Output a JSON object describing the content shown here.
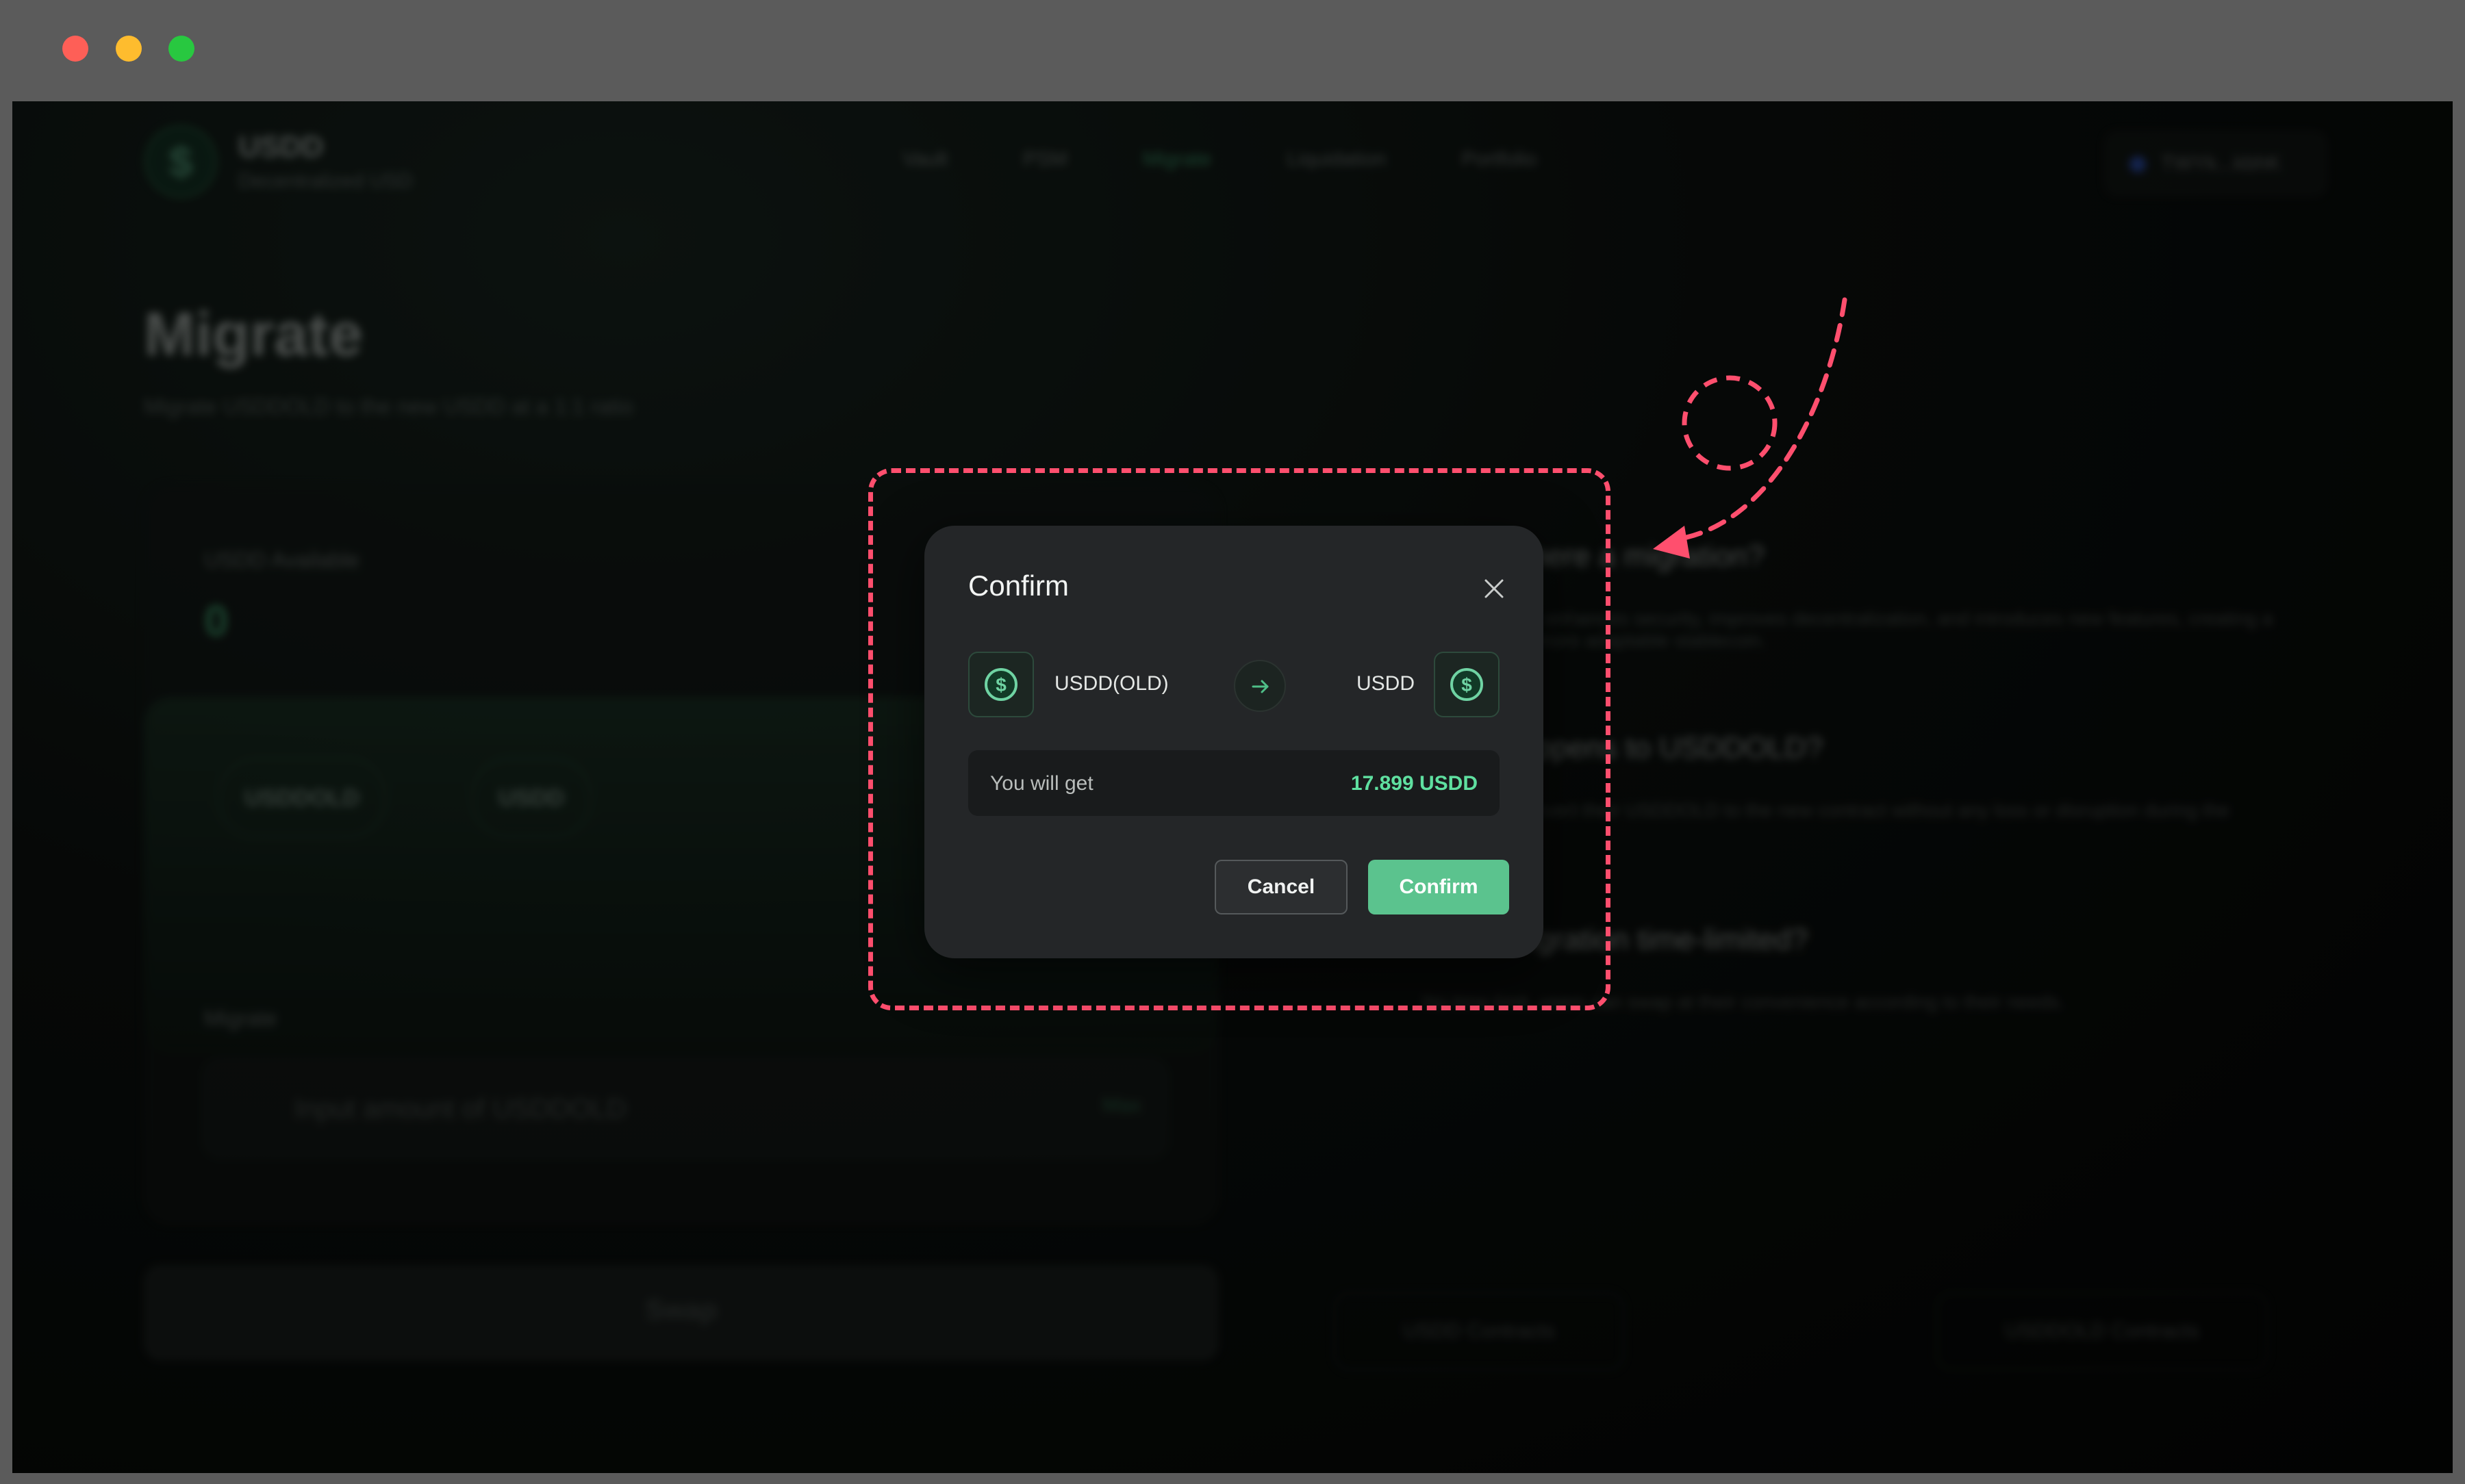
{
  "window": {
    "controls": [
      "close",
      "minimize",
      "maximize"
    ]
  },
  "app": {
    "brand_name": "USDD",
    "brand_sub": "Decentralized USD",
    "nav": [
      "Vault",
      "PSM",
      "Migrate",
      "Liquidation",
      "Portfolio"
    ],
    "active_nav": "Migrate",
    "wallet_label": "TWYk...kbhK",
    "page_title": "Migrate",
    "page_sub": "Migrate USDDOLD to the new USDD at a 1:1 ratio",
    "available_label": "USDD Available",
    "available_value": "0",
    "pill_from": "USDDOLD",
    "pill_to": "USDD",
    "migrate_label": "Migrate",
    "input_placeholder": "Input amount of USDDOLD",
    "max_label": "Max",
    "swap_label": "Swap",
    "faq": [
      {
        "q": "Why is there a migration?",
        "a": "The migration enhances security, improves decentralization, and introduces new features, creating a stronger and more adaptable stablecoin."
      },
      {
        "q": "What happens to USDDOLD?",
        "a": "Users can convert their USDDOLD to the new contract without any loss or disruption during the transition."
      },
      {
        "q": "Is the migration time-limited?",
        "a": "No time limit, users can swap at their convenience according to their needs."
      }
    ],
    "contract_left": "USDD Contracts",
    "contract_right": "USDDOLD Contracts"
  },
  "modal": {
    "title": "Confirm",
    "from_token": "USDD(OLD)",
    "to_token": "USDD",
    "get_label": "You will get",
    "get_value": "17.899 USDD",
    "cancel_label": "Cancel",
    "confirm_label": "Confirm"
  },
  "colors": {
    "accent": "#5bc38e",
    "highlight": "#ff4f6e",
    "value": "#5fe0a0"
  }
}
